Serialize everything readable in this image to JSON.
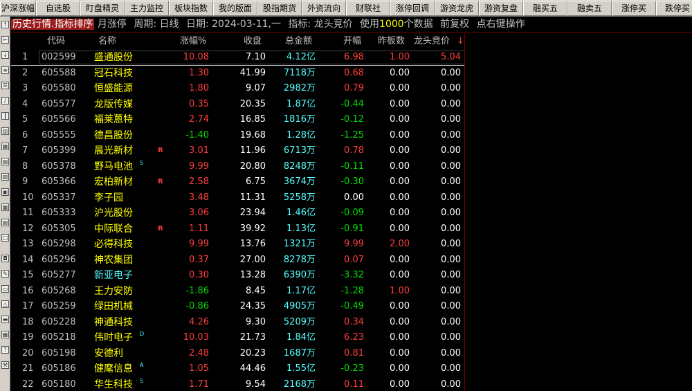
{
  "toolbar": {
    "buttons": [
      "沪深涨幅",
      "自选股",
      "盯盘精灵",
      "主力监控",
      "板块指数",
      "我的版面",
      "股指期货",
      "外资流向",
      "财联社",
      "涨停回调",
      "游资龙虎",
      "游资复盘",
      "融买五",
      "融卖五",
      "涨停买",
      "跌停买"
    ]
  },
  "title": {
    "mode": "历史行情.指标排序",
    "range": "月涨停",
    "period": "周期: 日线",
    "date": "日期: 2024-03-11,一",
    "indicator": "指标: 龙头竞价",
    "use_prefix": "使用",
    "use_count": "1000",
    "use_suffix": "个数据",
    "adjust": "前复权",
    "hint": "点右键操作"
  },
  "columns": {
    "code": "代码",
    "name": "名称",
    "change": "涨幅%",
    "close": "收盘",
    "amount": "总金额",
    "open": "开幅",
    "prev_board": "昨板数",
    "auction": "龙头竞价",
    "sort_arrow": "↓"
  },
  "rows": [
    {
      "idx": "1",
      "code": "002599",
      "name": "盛通股份",
      "mark": "",
      "flag": "",
      "change": "10.08",
      "close": "7.10",
      "amount": "4.12亿",
      "open": "6.98",
      "prev": "1.00",
      "auction": "5.04"
    },
    {
      "idx": "2",
      "code": "605588",
      "name": "冠石科技",
      "mark": "",
      "flag": "",
      "change": "1.30",
      "close": "41.99",
      "amount": "7118万",
      "open": "0.68",
      "prev": "0.00",
      "auction": "0.00"
    },
    {
      "idx": "3",
      "code": "605580",
      "name": "恒盛能源",
      "mark": "",
      "flag": "",
      "change": "1.80",
      "close": "9.07",
      "amount": "2982万",
      "open": "0.79",
      "prev": "0.00",
      "auction": "0.00"
    },
    {
      "idx": "4",
      "code": "605577",
      "name": "龙版传媒",
      "mark": "",
      "flag": "",
      "change": "0.35",
      "close": "20.35",
      "amount": "1.87亿",
      "open": "-0.44",
      "prev": "0.00",
      "auction": "0.00"
    },
    {
      "idx": "5",
      "code": "605566",
      "name": "福莱蒽特",
      "mark": "",
      "flag": "",
      "change": "2.74",
      "close": "16.85",
      "amount": "1816万",
      "open": "-0.12",
      "prev": "0.00",
      "auction": "0.00"
    },
    {
      "idx": "6",
      "code": "605555",
      "name": "德昌股份",
      "mark": "",
      "flag": "",
      "change": "-1.40",
      "close": "19.68",
      "amount": "1.28亿",
      "open": "-1.25",
      "prev": "0.00",
      "auction": "0.00"
    },
    {
      "idx": "7",
      "code": "605399",
      "name": "晨光新材",
      "mark": "",
      "flag": "R",
      "change": "3.01",
      "close": "11.96",
      "amount": "6713万",
      "open": "0.78",
      "prev": "0.00",
      "auction": "0.00"
    },
    {
      "idx": "8",
      "code": "605378",
      "name": "野马电池",
      "mark": "S",
      "flag": "",
      "change": "9.99",
      "close": "20.80",
      "amount": "8248万",
      "open": "-0.11",
      "prev": "0.00",
      "auction": "0.00"
    },
    {
      "idx": "9",
      "code": "605366",
      "name": "宏柏新材",
      "mark": "",
      "flag": "R",
      "change": "2.58",
      "close": "6.75",
      "amount": "3674万",
      "open": "-0.30",
      "prev": "0.00",
      "auction": "0.00"
    },
    {
      "idx": "10",
      "code": "605337",
      "name": "李子园",
      "mark": "",
      "flag": "",
      "change": "3.48",
      "close": "11.31",
      "amount": "5258万",
      "open": "0.00",
      "prev": "0.00",
      "auction": "0.00"
    },
    {
      "idx": "11",
      "code": "605333",
      "name": "沪光股份",
      "mark": "",
      "flag": "",
      "change": "3.06",
      "close": "23.94",
      "amount": "1.46亿",
      "open": "-0.09",
      "prev": "0.00",
      "auction": "0.00"
    },
    {
      "idx": "12",
      "code": "605305",
      "name": "中际联合",
      "mark": "",
      "flag": "R",
      "change": "1.11",
      "close": "39.92",
      "amount": "1.13亿",
      "open": "-0.91",
      "prev": "0.00",
      "auction": "0.00"
    },
    {
      "idx": "13",
      "code": "605298",
      "name": "必得科技",
      "mark": "",
      "flag": "",
      "change": "9.99",
      "close": "13.76",
      "amount": "1321万",
      "open": "9.99",
      "prev": "2.00",
      "auction": "0.00"
    },
    {
      "idx": "14",
      "code": "605296",
      "name": "神农集团",
      "mark": "",
      "flag": "",
      "change": "0.37",
      "close": "27.00",
      "amount": "8278万",
      "open": "0.07",
      "prev": "0.00",
      "auction": "0.00"
    },
    {
      "idx": "15",
      "code": "605277",
      "name": "新亚电子",
      "mark": "",
      "flag": "",
      "change": "0.30",
      "close": "13.28",
      "amount": "6390万",
      "open": "-3.32",
      "prev": "0.00",
      "auction": "0.00",
      "cyan": true
    },
    {
      "idx": "16",
      "code": "605268",
      "name": "王力安防",
      "mark": "",
      "flag": "",
      "change": "-1.86",
      "close": "8.45",
      "amount": "1.17亿",
      "open": "-1.28",
      "prev": "1.00",
      "auction": "0.00"
    },
    {
      "idx": "17",
      "code": "605259",
      "name": "绿田机械",
      "mark": "",
      "flag": "",
      "change": "-0.86",
      "close": "24.35",
      "amount": "4905万",
      "open": "-0.49",
      "prev": "0.00",
      "auction": "0.00"
    },
    {
      "idx": "18",
      "code": "605228",
      "name": "神通科技",
      "mark": "",
      "flag": "",
      "change": "4.26",
      "close": "9.30",
      "amount": "5209万",
      "open": "0.34",
      "prev": "0.00",
      "auction": "0.00"
    },
    {
      "idx": "19",
      "code": "605218",
      "name": "伟时电子",
      "mark": "D",
      "flag": "",
      "change": "10.03",
      "close": "21.73",
      "amount": "1.84亿",
      "open": "6.23",
      "prev": "0.00",
      "auction": "0.00"
    },
    {
      "idx": "20",
      "code": "605198",
      "name": "安德利",
      "mark": "",
      "flag": "",
      "change": "2.48",
      "close": "20.23",
      "amount": "1687万",
      "open": "0.81",
      "prev": "0.00",
      "auction": "0.00"
    },
    {
      "idx": "21",
      "code": "605186",
      "name": "健麾信息",
      "mark": "A",
      "flag": "",
      "change": "1.05",
      "close": "44.46",
      "amount": "1.55亿",
      "open": "-0.23",
      "prev": "0.00",
      "auction": "0.00"
    },
    {
      "idx": "22",
      "code": "605180",
      "name": "华生科技",
      "mark": "S",
      "flag": "",
      "change": "1.71",
      "close": "9.54",
      "amount": "2168万",
      "open": "0.11",
      "prev": "0.00",
      "auction": "0.00"
    }
  ],
  "colors": {
    "up": "#ff3c3c",
    "down": "#00dc00",
    "name": "#ffff00",
    "amount": "#54ffff",
    "background": "#000000"
  }
}
